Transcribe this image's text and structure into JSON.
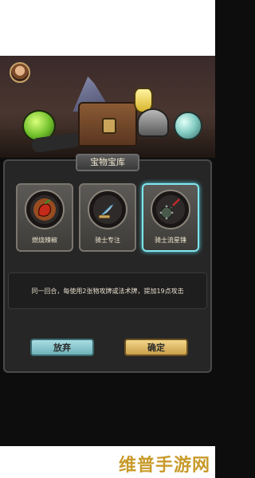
{
  "dialog": {
    "title": "宝物宝库"
  },
  "cards": [
    {
      "label": "燃烧辣椒",
      "icon": "chili-pepper-icon",
      "selected": false
    },
    {
      "label": "骑士专注",
      "icon": "feather-scroll-icon",
      "selected": false
    },
    {
      "label": "骑士流星锤",
      "icon": "flail-icon",
      "selected": true
    }
  ],
  "description": "同一回合，每使用2张物攻牌或法术牌，提加19点攻击",
  "buttons": {
    "abandon": "放弃",
    "confirm": "确定"
  },
  "watermark": "维普手游网",
  "colors": {
    "selected_border": "#7fe6f0",
    "abandon_button": "#8fcdd4",
    "confirm_button": "#e0bc6a"
  }
}
